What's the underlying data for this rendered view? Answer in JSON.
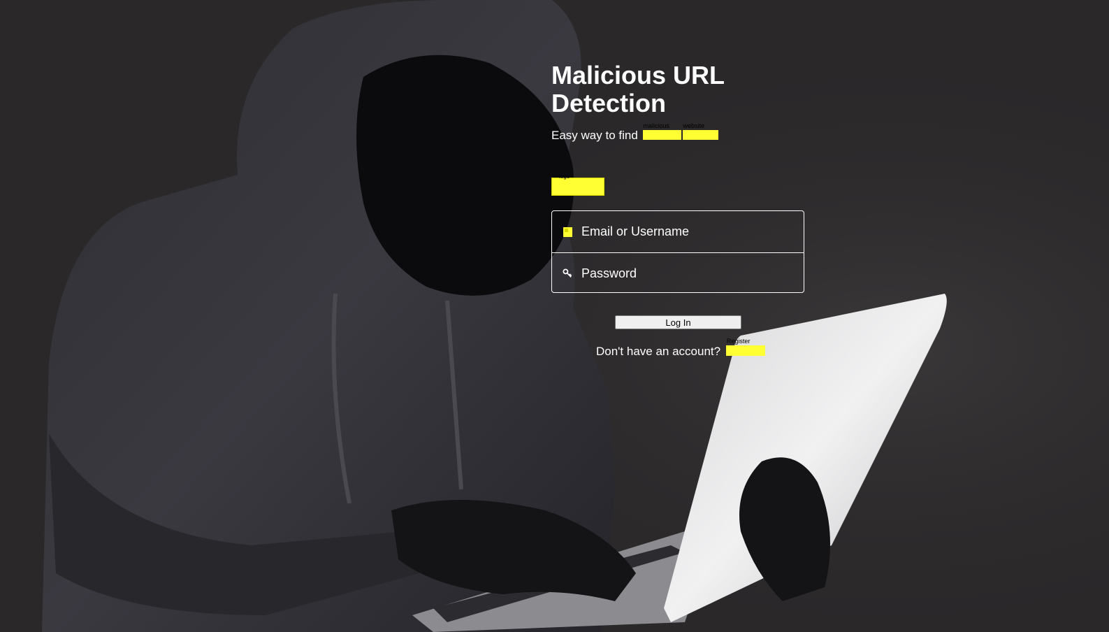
{
  "app": {
    "title": "Malicious  URL Detection",
    "tagline_prefix": "Easy way to find",
    "tagline_word1": "malicious",
    "tagline_word2": "website"
  },
  "logo": {
    "alt": "logo"
  },
  "form": {
    "email_placeholder": "Email or Username",
    "password_placeholder": "Password",
    "login_label": "Log In"
  },
  "footer": {
    "prompt": "Don't have an account?",
    "register_label": "Register"
  },
  "colors": {
    "background": "#2a2829",
    "highlight": "#ffff33",
    "text": "#ffffff"
  },
  "icons": {
    "email": "user-icon",
    "password": "key-icon"
  }
}
